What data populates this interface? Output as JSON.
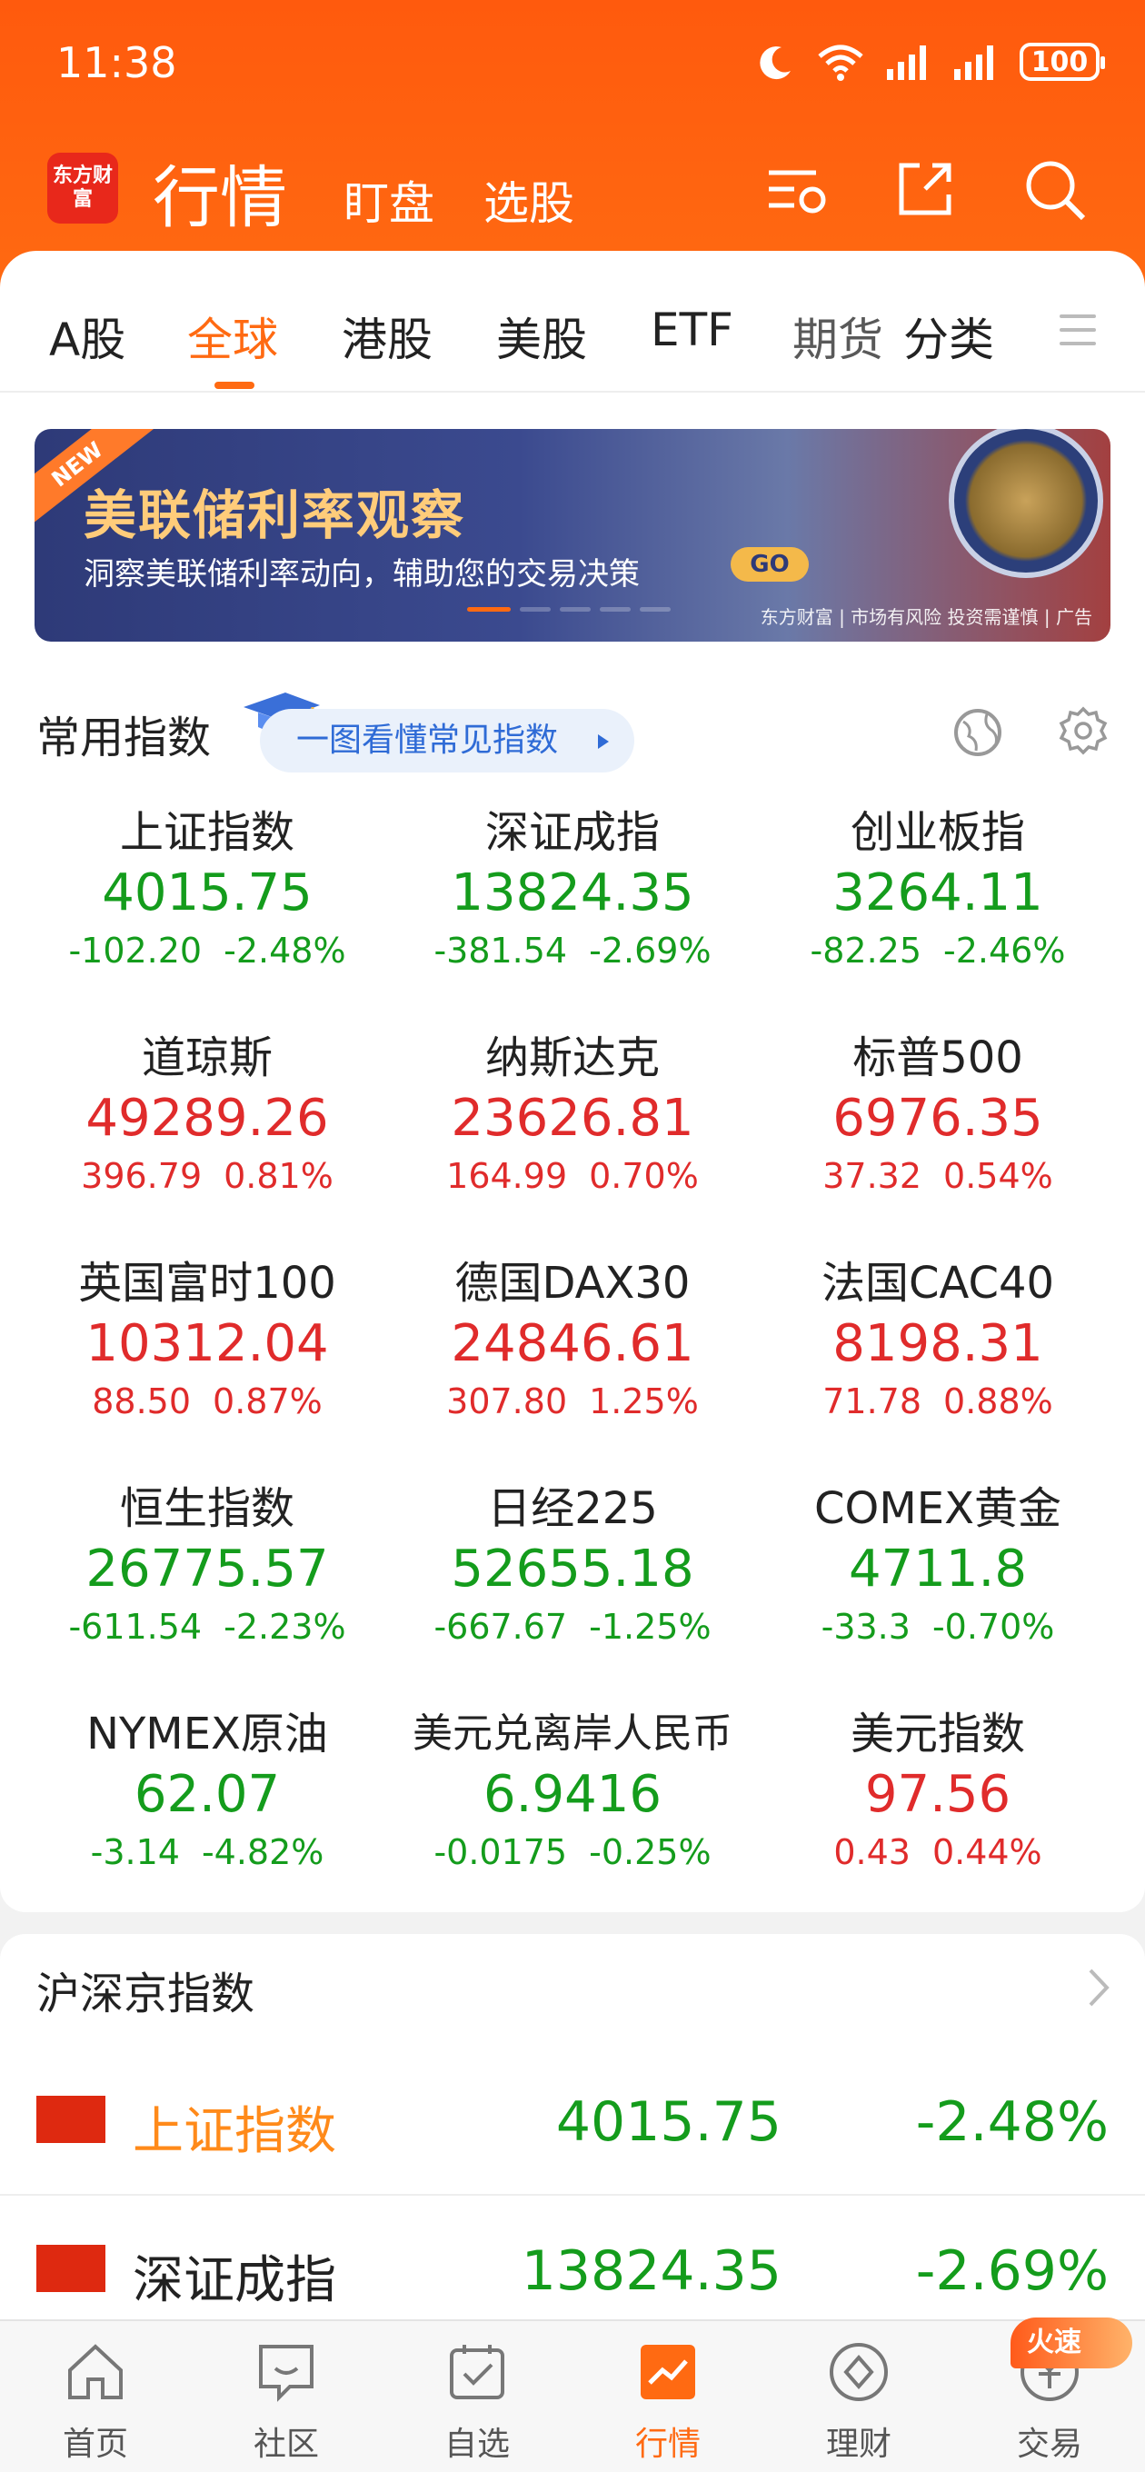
{
  "status": {
    "time": "11:38",
    "battery": "100"
  },
  "header": {
    "logo_text": "东方财富",
    "title": "行情",
    "tabs": [
      "盯盘",
      "选股"
    ]
  },
  "market_tabs": [
    {
      "label": "A股",
      "active": false
    },
    {
      "label": "全球",
      "active": true
    },
    {
      "label": "港股",
      "active": false
    },
    {
      "label": "美股",
      "active": false
    },
    {
      "label": "ETF",
      "active": false
    },
    {
      "label": "期货",
      "active": false
    },
    {
      "label": "分类",
      "active": false
    }
  ],
  "banner": {
    "ribbon": "NEW",
    "title": "美联储利率观察",
    "subtitle": "洞察美联储利率动向，辅助您的交易决策",
    "go_label": "GO",
    "brand": "东方财富 | 市场有风险 投资需谨慎 | 广告"
  },
  "common_indices": {
    "title": "常用指数",
    "hint": "一图看懂常见指数",
    "items": [
      {
        "name": "上证指数",
        "price": "4015.75",
        "change": "-102.20",
        "pct": "-2.48%",
        "dir": "down"
      },
      {
        "name": "深证成指",
        "price": "13824.35",
        "change": "-381.54",
        "pct": "-2.69%",
        "dir": "down"
      },
      {
        "name": "创业板指",
        "price": "3264.11",
        "change": "-82.25",
        "pct": "-2.46%",
        "dir": "down"
      },
      {
        "name": "道琼斯",
        "price": "49289.26",
        "change": "396.79",
        "pct": "0.81%",
        "dir": "up"
      },
      {
        "name": "纳斯达克",
        "price": "23626.81",
        "change": "164.99",
        "pct": "0.70%",
        "dir": "up"
      },
      {
        "name": "标普500",
        "price": "6976.35",
        "change": "37.32",
        "pct": "0.54%",
        "dir": "up"
      },
      {
        "name": "英国富时100",
        "price": "10312.04",
        "change": "88.50",
        "pct": "0.87%",
        "dir": "up"
      },
      {
        "name": "德国DAX30",
        "price": "24846.61",
        "change": "307.80",
        "pct": "1.25%",
        "dir": "up"
      },
      {
        "name": "法国CAC40",
        "price": "8198.31",
        "change": "71.78",
        "pct": "0.88%",
        "dir": "up"
      },
      {
        "name": "恒生指数",
        "price": "26775.57",
        "change": "-611.54",
        "pct": "-2.23%",
        "dir": "down"
      },
      {
        "name": "日经225",
        "price": "52655.18",
        "change": "-667.67",
        "pct": "-1.25%",
        "dir": "down"
      },
      {
        "name": "COMEX黄金",
        "price": "4711.8",
        "change": "-33.3",
        "pct": "-0.70%",
        "dir": "down"
      },
      {
        "name": "NYMEX原油",
        "price": "62.07",
        "change": "-3.14",
        "pct": "-4.82%",
        "dir": "down"
      },
      {
        "name": "美元兑离岸人民币",
        "price": "6.9416",
        "change": "-0.0175",
        "pct": "-0.25%",
        "dir": "down"
      },
      {
        "name": "美元指数",
        "price": "97.56",
        "change": "0.43",
        "pct": "0.44%",
        "dir": "up"
      }
    ]
  },
  "hsj_indices": {
    "title": "沪深京指数",
    "rows": [
      {
        "name": "上证指数",
        "price": "4015.75",
        "pct": "-2.48%",
        "highlight": true
      },
      {
        "name": "深证成指",
        "price": "13824.35",
        "pct": "-2.69%",
        "highlight": false
      }
    ]
  },
  "bottom_nav": {
    "items": [
      {
        "label": "首页",
        "icon": "home-icon",
        "active": false
      },
      {
        "label": "社区",
        "icon": "community-icon",
        "active": false
      },
      {
        "label": "自选",
        "icon": "watchlist-icon",
        "active": false
      },
      {
        "label": "行情",
        "icon": "market-icon",
        "active": true
      },
      {
        "label": "理财",
        "icon": "wealth-icon",
        "active": false
      },
      {
        "label": "交易",
        "icon": "trade-icon",
        "active": false
      }
    ],
    "badge": "火速"
  },
  "colors": {
    "accent": "#ff6a12",
    "up": "#e02b2b",
    "down": "#149c1c"
  }
}
